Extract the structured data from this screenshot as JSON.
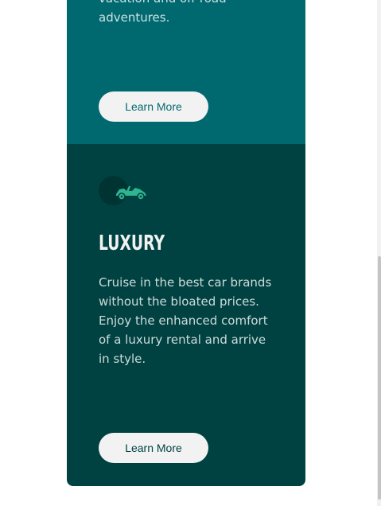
{
  "colors": {
    "card_top_bg": "#006970",
    "card_bottom_bg": "#004241",
    "button_bg": "#f2f2f2",
    "icon_color": "#2fb58f"
  },
  "top_card": {
    "description": "vacation and off-road adventures.",
    "button_label": "Learn More"
  },
  "bottom_card": {
    "icon": "luxury-car-icon",
    "title": "LUXURY",
    "description": "Cruise in the best car brands without the bloated prices. Enjoy the enhanced comfort of a luxury rental and arrive in style.",
    "button_label": "Learn More"
  }
}
